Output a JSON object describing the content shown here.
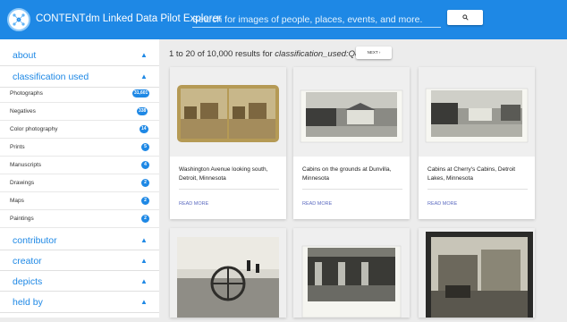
{
  "header": {
    "brand": "CONTENTdm Linked Data Pilot Explorer",
    "search_placeholder": "Search for images of people, places, events, and more.",
    "search_icon": "magnifier-icon"
  },
  "sidebar": {
    "sections_top": [
      {
        "label": "about"
      }
    ],
    "classification": {
      "label": "classification used",
      "items": [
        {
          "name": "Photographs",
          "count": "31,601"
        },
        {
          "name": "Negatives",
          "count": "338"
        },
        {
          "name": "Color photography",
          "count": "14"
        },
        {
          "name": "Prints",
          "count": "5"
        },
        {
          "name": "Manuscripts",
          "count": "4"
        },
        {
          "name": "Drawings",
          "count": "2"
        },
        {
          "name": "Maps",
          "count": "2"
        },
        {
          "name": "Paintings",
          "count": "2"
        }
      ]
    },
    "sections_bottom": [
      {
        "label": "contributor"
      },
      {
        "label": "creator"
      },
      {
        "label": "depicts"
      },
      {
        "label": "held by"
      }
    ],
    "chevron_icon": "chevron-up-icon"
  },
  "results": {
    "summary": "1 to 20 of 10,000 results for",
    "query": "classification_used:Q84383.",
    "next_label": "NEXT ›"
  },
  "cards": [
    {
      "title": "Washington Avenue looking south, Detroit, Minnesota",
      "more": "READ MORE"
    },
    {
      "title": "Cabins on the grounds at Dunvilla, Minnesota",
      "more": "READ MORE"
    },
    {
      "title": "Cabins at Cherry's Cabins, Detroit Lakes, Minnesota",
      "more": "READ MORE"
    },
    {
      "title": "",
      "more": ""
    },
    {
      "title": "",
      "more": ""
    },
    {
      "title": "",
      "more": ""
    }
  ]
}
